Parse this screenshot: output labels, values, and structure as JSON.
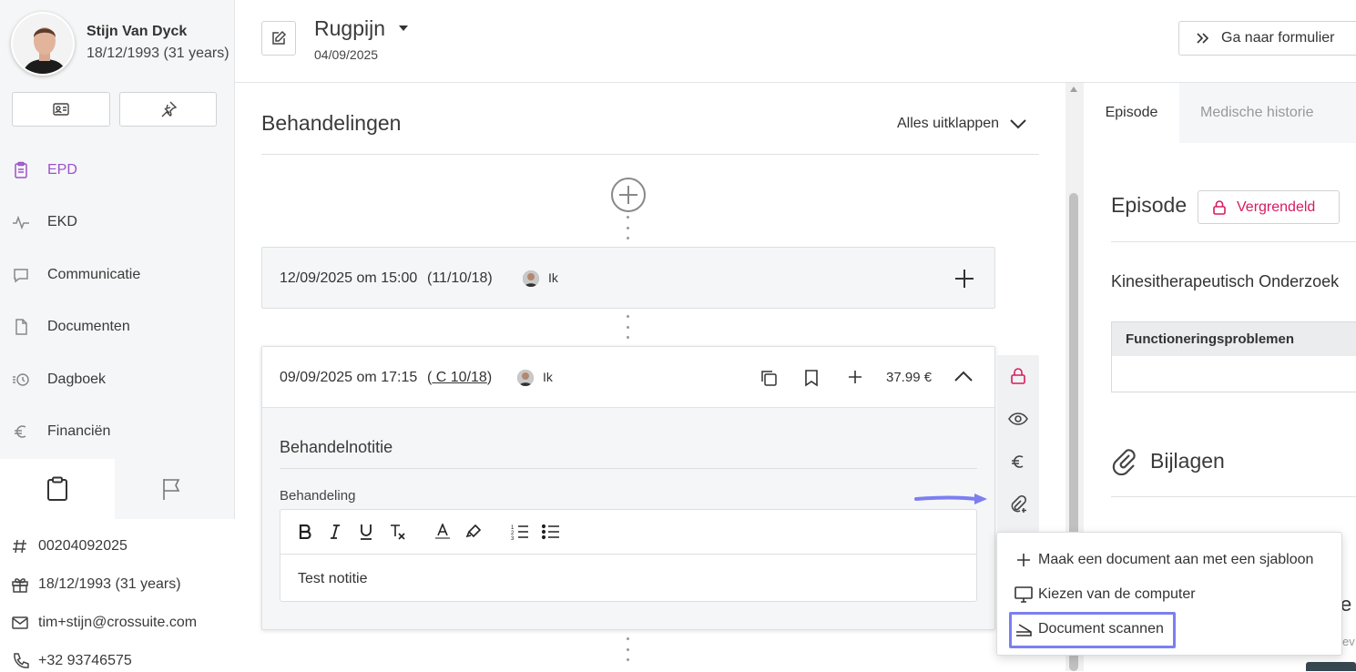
{
  "patient": {
    "name": "Stijn Van Dyck",
    "dob": "18/12/1993 (31 years)",
    "number": "00204092025",
    "birthday": "18/12/1993 (31 years)",
    "email": "tim+stijn@crossuite.com",
    "phone": "+32 93746575"
  },
  "nav": [
    {
      "label": "EPD",
      "icon": "clipboard-icon",
      "active": true
    },
    {
      "label": "EKD",
      "icon": "activity-icon",
      "active": false
    },
    {
      "label": "Communicatie",
      "icon": "chat-icon",
      "active": false
    },
    {
      "label": "Documenten",
      "icon": "document-icon",
      "active": false
    },
    {
      "label": "Dagboek",
      "icon": "history-icon",
      "active": false
    },
    {
      "label": "Financiën",
      "icon": "euro-icon",
      "active": false
    }
  ],
  "header": {
    "case_title": "Rugpijn",
    "case_date": "04/09/2025",
    "goto_label": "Ga naar formulier"
  },
  "treatments": {
    "title": "Behandelingen",
    "expand_all": "Alles uitklappen",
    "items": [
      {
        "date": "12/09/2025 om 15:00",
        "code": "(11/10/18)",
        "therapist": "Ik"
      },
      {
        "date": "09/09/2025 om 17:15",
        "code_prefix": "(",
        "code": " C 10/18",
        "code_suffix": ")",
        "therapist": "Ik",
        "price": "37.99 €"
      }
    ],
    "note_title": "Behandelnotitie",
    "field_label": "Behandeling",
    "editor_text": "Test notitie"
  },
  "right": {
    "tabs": [
      "Episode",
      "Medische historie"
    ],
    "episode_title": "Episode",
    "locked_label": "Vergrendeld",
    "exam_title": "Kinesitherapeutisch Onderzoek",
    "problems_header": "Functioneringsproblemen",
    "attachments_title": "Bijlagen",
    "partial_letter": "e",
    "partial_text": "ev"
  },
  "attach_menu": {
    "items": [
      {
        "label": "Maak een document aan met een sjabloon",
        "icon": "plus-icon"
      },
      {
        "label": "Kiezen van de computer",
        "icon": "monitor-icon"
      },
      {
        "label": "Document scannen",
        "icon": "scanner-icon"
      }
    ]
  },
  "colors": {
    "accent_purple": "#9b52c9",
    "lock_red": "#d81b60",
    "highlight": "#7b7ff0"
  }
}
